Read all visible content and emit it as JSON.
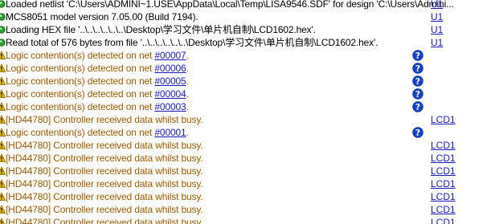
{
  "colors": {
    "info_text": "#000000",
    "warning_text": "#a05a00",
    "link": "#1a1acc",
    "info_icon": "#2ea02e",
    "warning_icon": "#e8c000",
    "help_icon": "#1440c8"
  },
  "log": [
    {
      "level": "info",
      "icon": "green-dot-icon",
      "prefix": "Loaded netlist 'C:\\Users\\ADMINI~1.USE\\AppData\\Local\\Temp\\LISA9546.SDF' for design 'C:\\Users\\Admini...",
      "net": "",
      "suffix": "",
      "help": false,
      "source": "U1"
    },
    {
      "level": "info",
      "icon": "green-dot-icon",
      "prefix": "MCS8051 model version 7.05.00 (Build 7194).",
      "net": "",
      "suffix": "",
      "help": false,
      "source": "U1"
    },
    {
      "level": "info",
      "icon": "green-dot-icon",
      "prefix": "Loading HEX file '..\\..\\..\\..\\..\\..\\Desktop\\学习文件\\单片机自制\\LCD1602.hex'.",
      "net": "",
      "suffix": "",
      "help": false,
      "source": "U1"
    },
    {
      "level": "info",
      "icon": "green-dot-icon",
      "prefix": "Read total of 576 bytes from file '..\\..\\..\\..\\..\\..\\Desktop\\学习文件\\单片机自制\\LCD1602.hex'.",
      "net": "",
      "suffix": "",
      "help": false,
      "source": "U1"
    },
    {
      "level": "warning",
      "icon": "warning-triangle-icon",
      "prefix": "Logic contention(s) detected on net ",
      "net": "#00007",
      "suffix": ".",
      "help": true,
      "source": ""
    },
    {
      "level": "warning",
      "icon": "warning-triangle-icon",
      "prefix": "Logic contention(s) detected on net ",
      "net": "#00006",
      "suffix": ".",
      "help": true,
      "source": ""
    },
    {
      "level": "warning",
      "icon": "warning-triangle-icon",
      "prefix": "Logic contention(s) detected on net ",
      "net": "#00005",
      "suffix": ".",
      "help": true,
      "source": ""
    },
    {
      "level": "warning",
      "icon": "warning-triangle-icon",
      "prefix": "Logic contention(s) detected on net ",
      "net": "#00004",
      "suffix": ".",
      "help": true,
      "source": ""
    },
    {
      "level": "warning",
      "icon": "warning-triangle-icon",
      "prefix": "Logic contention(s) detected on net ",
      "net": "#00003",
      "suffix": ".",
      "help": true,
      "source": ""
    },
    {
      "level": "warning",
      "icon": "warning-triangle-icon",
      "prefix": "[HD44780] Controller received data whilst busy.",
      "net": "",
      "suffix": "",
      "help": false,
      "source": "LCD1"
    },
    {
      "level": "warning",
      "icon": "warning-triangle-icon",
      "prefix": "Logic contention(s) detected on net ",
      "net": "#00001",
      "suffix": ".",
      "help": true,
      "source": ""
    },
    {
      "level": "warning",
      "icon": "warning-triangle-icon",
      "prefix": "[HD44780] Controller received data whilst busy.",
      "net": "",
      "suffix": "",
      "help": false,
      "source": "LCD1"
    },
    {
      "level": "warning",
      "icon": "warning-triangle-icon",
      "prefix": "[HD44780] Controller received data whilst busy.",
      "net": "",
      "suffix": "",
      "help": false,
      "source": "LCD1"
    },
    {
      "level": "warning",
      "icon": "warning-triangle-icon",
      "prefix": "[HD44780] Controller received data whilst busy.",
      "net": "",
      "suffix": "",
      "help": false,
      "source": "LCD1"
    },
    {
      "level": "warning",
      "icon": "warning-triangle-icon",
      "prefix": "[HD44780] Controller received data whilst busy.",
      "net": "",
      "suffix": "",
      "help": false,
      "source": "LCD1"
    },
    {
      "level": "warning",
      "icon": "warning-triangle-icon",
      "prefix": "[HD44780] Controller received data whilst busy.",
      "net": "",
      "suffix": "",
      "help": false,
      "source": "LCD1"
    },
    {
      "level": "warning",
      "icon": "warning-triangle-icon",
      "prefix": "[HD44780] Controller received data whilst busy.",
      "net": "",
      "suffix": "",
      "help": false,
      "source": "LCD1"
    },
    {
      "level": "warning",
      "icon": "warning-triangle-icon",
      "prefix": "[HD44780] Controller received data whilst busy.",
      "net": "",
      "suffix": "",
      "help": false,
      "source": "LCD1"
    }
  ]
}
